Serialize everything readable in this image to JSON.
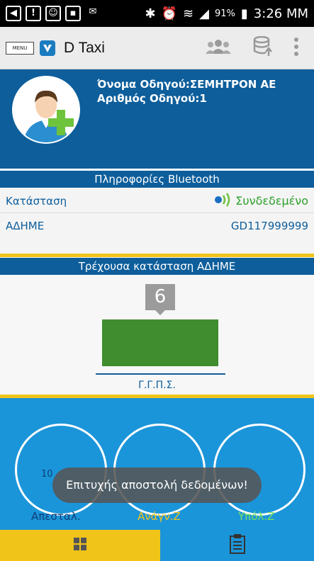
{
  "status_bar": {
    "battery": "91%",
    "time": "3:26 MM",
    "icons": [
      "back-icon",
      "alert-icon",
      "smiley-icon",
      "image-icon",
      "sms-icon",
      "bluetooth-icon",
      "alarm-icon",
      "wifi-icon",
      "signal-icon",
      "battery-icon"
    ]
  },
  "appbar": {
    "menu_label": "MENU",
    "title": "D Taxi",
    "actions": [
      "users-icon",
      "database-upload-icon",
      "overflow-menu-icon"
    ]
  },
  "driver": {
    "name_line": "Όνομα Οδηγού:ΣΕΜΗΤΡΟΝ ΑΕ",
    "number_line": "Αριθμός Οδηγού:1"
  },
  "bluetooth": {
    "header": "Πληροφορίες Bluetooth",
    "status_label": "Κατάσταση",
    "status_value": "Συνδεδεμένο",
    "device_label": "ΑΔΗΜΕ",
    "device_value": "GD117999999"
  },
  "current_state": {
    "header": "Τρέχουσα κατάσταση ΑΔΗΜΕ",
    "number": "6",
    "label": "Γ.Γ.Π.Σ."
  },
  "gauges": {
    "sent_label": "Απεσταλ.",
    "read_label": "Ανάγν.Ζ",
    "remaining_label": "Υπόλ.Ζ",
    "sent_value_partial": "10"
  },
  "toast": "Επιτυχής αποστολή δεδομένων!",
  "bottom_nav": [
    "dashboard-icon",
    "clipboard-icon"
  ],
  "colors": {
    "primary": "#0d5e9b",
    "accent": "#f0c419",
    "green": "#3f8d2e",
    "gauge_bg": "#1b95d9"
  }
}
